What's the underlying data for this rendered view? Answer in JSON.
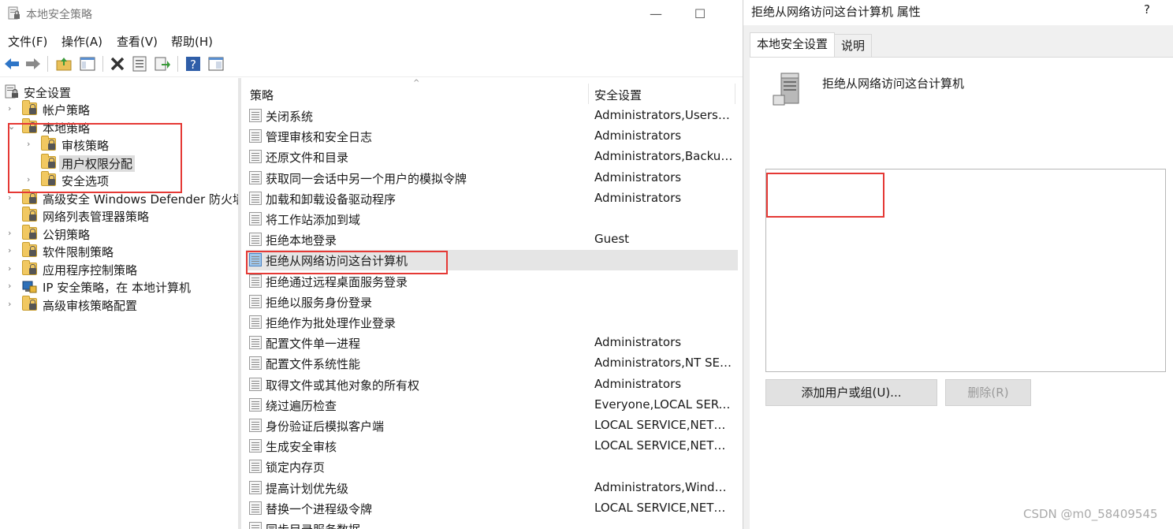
{
  "window": {
    "title": "本地安全策略",
    "minimize_glyph": "—",
    "maximize_glyph": "☐"
  },
  "menu": [
    "文件(F)",
    "操作(A)",
    "查看(V)",
    "帮助(H)"
  ],
  "toolbar": {
    "icons": [
      "back-arrow-icon",
      "forward-arrow-icon",
      "up-folder-icon",
      "show-hide-tree-icon",
      "delete-icon",
      "properties-icon",
      "export-list-icon",
      "help-icon",
      "view-icon"
    ]
  },
  "tree": {
    "root": "安全设置",
    "items": [
      {
        "label": "帐户策略",
        "expandable": true,
        "level": 1
      },
      {
        "label": "本地策略",
        "expandable": true,
        "expanded": true,
        "level": 1
      },
      {
        "label": "审核策略",
        "expandable": true,
        "level": 2
      },
      {
        "label": "用户权限分配",
        "expandable": false,
        "level": 2,
        "selected": true
      },
      {
        "label": "安全选项",
        "expandable": true,
        "level": 2
      },
      {
        "label": "高级安全 Windows Defender 防火墙",
        "expandable": true,
        "level": 1
      },
      {
        "label": "网络列表管理器策略",
        "expandable": false,
        "level": 1
      },
      {
        "label": "公钥策略",
        "expandable": true,
        "level": 1
      },
      {
        "label": "软件限制策略",
        "expandable": true,
        "level": 1
      },
      {
        "label": "应用程序控制策略",
        "expandable": true,
        "level": 1
      },
      {
        "label": "IP 安全策略，在 本地计算机",
        "expandable": true,
        "level": 1,
        "icon": "ip-security-icon"
      },
      {
        "label": "高级审核策略配置",
        "expandable": true,
        "level": 1
      }
    ]
  },
  "list": {
    "columns": [
      "策略",
      "安全设置"
    ],
    "rows": [
      {
        "name": "关闭系统",
        "value": "Administrators,Users,Ba..."
      },
      {
        "name": "管理审核和安全日志",
        "value": "Administrators"
      },
      {
        "name": "还原文件和目录",
        "value": "Administrators,Backup ..."
      },
      {
        "name": "获取同一会话中另一个用户的模拟令牌",
        "value": "Administrators"
      },
      {
        "name": "加载和卸载设备驱动程序",
        "value": "Administrators"
      },
      {
        "name": "将工作站添加到域",
        "value": ""
      },
      {
        "name": "拒绝本地登录",
        "value": "Guest"
      },
      {
        "name": "拒绝从网络访问这台计算机",
        "value": "",
        "selected": true
      },
      {
        "name": "拒绝通过远程桌面服务登录",
        "value": ""
      },
      {
        "name": "拒绝以服务身份登录",
        "value": ""
      },
      {
        "name": "拒绝作为批处理作业登录",
        "value": ""
      },
      {
        "name": "配置文件单一进程",
        "value": "Administrators"
      },
      {
        "name": "配置文件系统性能",
        "value": "Administrators,NT SER..."
      },
      {
        "name": "取得文件或其他对象的所有权",
        "value": "Administrators"
      },
      {
        "name": "绕过遍历检查",
        "value": "Everyone,LOCAL SERVI..."
      },
      {
        "name": "身份验证后模拟客户端",
        "value": "LOCAL SERVICE,NETW..."
      },
      {
        "name": "生成安全审核",
        "value": "LOCAL SERVICE,NETW..."
      },
      {
        "name": "锁定内存页",
        "value": ""
      },
      {
        "name": "提高计划优先级",
        "value": "Administrators,Window ..."
      },
      {
        "name": "替换一个进程级令牌",
        "value": "LOCAL SERVICE,NETW..."
      },
      {
        "name": "同步目录服务数据",
        "value": ""
      }
    ]
  },
  "dialog": {
    "title": "拒绝从网络访问这台计算机 属性",
    "help": "?",
    "tabs": [
      "本地安全设置",
      "说明"
    ],
    "policy_name": "拒绝从网络访问这台计算机",
    "add_button": "添加用户或组(U)...",
    "remove_button": "删除(R)"
  },
  "watermark": "CSDN @m0_58409545",
  "colors": {
    "highlight": "#e53935",
    "selection": "#e5e5e5"
  }
}
